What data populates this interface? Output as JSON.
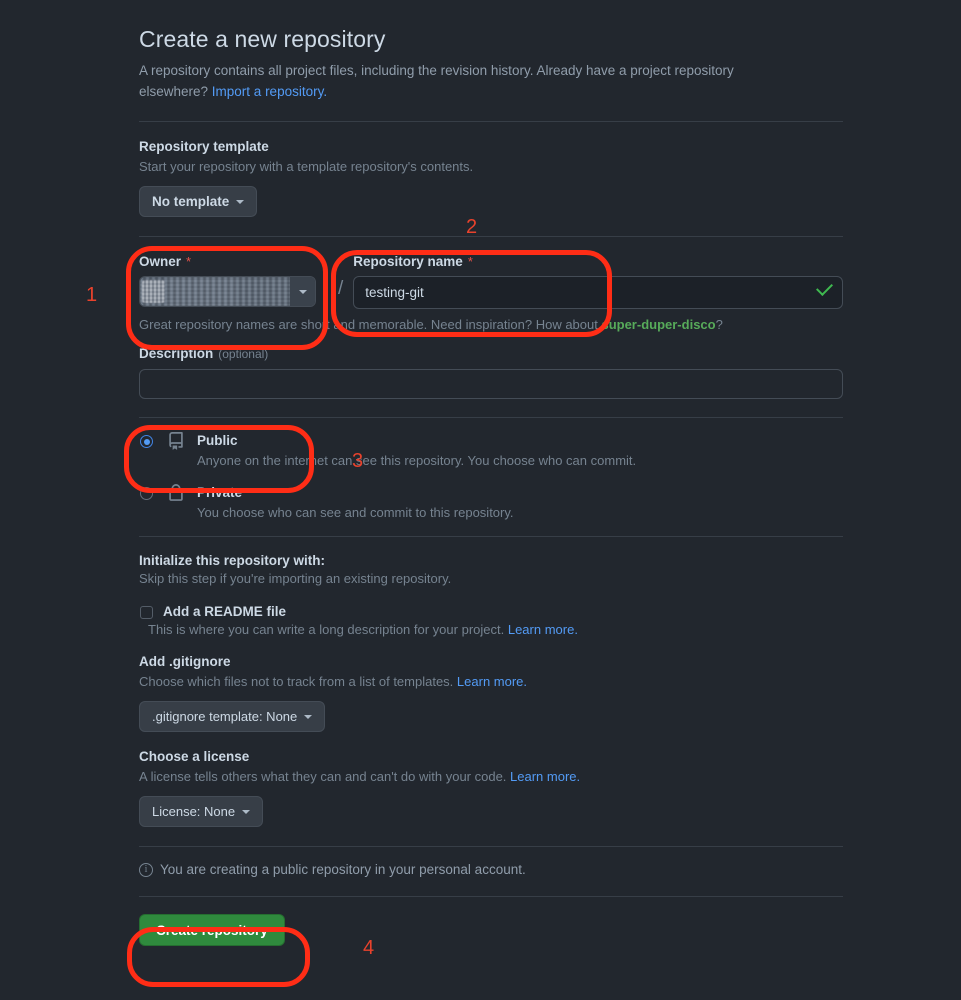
{
  "header": {
    "title": "Create a new repository",
    "description_1": "A repository contains all project files, including the revision history. Already have a project repository elsewhere? ",
    "import_link": "Import a repository."
  },
  "template_section": {
    "label": "Repository template",
    "help": "Start your repository with a template repository's contents.",
    "button_label": "No template",
    "caret_icon": "chevron-down-icon"
  },
  "owner": {
    "label": "Owner",
    "required_mark": "*",
    "value": "",
    "redacted": true,
    "caret_icon": "chevron-down-icon",
    "separator": "/"
  },
  "repo_name": {
    "label": "Repository name",
    "required_mark": "*",
    "value": "testing-git",
    "placeholder": "",
    "valid_icon": "check-icon",
    "help_prefix": "Great repository names are short and memorable. Need inspiration? How about ",
    "suggestion": "super-duper-disco",
    "help_suffix": "?"
  },
  "description": {
    "label": "Description",
    "optional_note": "(optional)",
    "value": "",
    "placeholder": ""
  },
  "visibility": {
    "options": [
      {
        "id": "public",
        "title": "Public",
        "description": "Anyone on the internet can see this repository. You choose who can commit.",
        "icon": "repo-book-icon",
        "selected": true
      },
      {
        "id": "private",
        "title": "Private",
        "description": "You choose who can see and commit to this repository.",
        "icon": "lock-icon",
        "selected": false
      }
    ]
  },
  "initialize": {
    "title": "Initialize this repository with:",
    "subtitle": "Skip this step if you're importing an existing repository.",
    "readme": {
      "label": "Add a README file",
      "description": "This is where you can write a long description for your project. ",
      "learn_more": "Learn more.",
      "checked": false
    },
    "gitignore": {
      "label": "Add .gitignore",
      "description": "Choose which files not to track from a list of templates. ",
      "learn_more": "Learn more.",
      "button_label": ".gitignore template: None",
      "caret_icon": "chevron-down-icon"
    },
    "license": {
      "label": "Choose a license",
      "description": "A license tells others what they can and can't do with your code. ",
      "learn_more": "Learn more.",
      "button_label": "License: None",
      "caret_icon": "chevron-down-icon"
    }
  },
  "footer": {
    "info_icon": "info-icon",
    "note": "You are creating a public repository in your personal account.",
    "create_button": "Create repository"
  },
  "annotations": [
    {
      "number": "1",
      "target": "owner-field"
    },
    {
      "number": "2",
      "target": "repository-name-field"
    },
    {
      "number": "3",
      "target": "public-visibility-option"
    },
    {
      "number": "4",
      "target": "create-repository-button"
    }
  ],
  "colors": {
    "page_background": "#22272e",
    "accent_link": "#539bf5",
    "success_green": "#3fb950",
    "suggestion_green": "#57ab5a",
    "create_button": "#2f8a3d",
    "annotation_red": "#ff2d16",
    "required_red": "#e5534b"
  }
}
